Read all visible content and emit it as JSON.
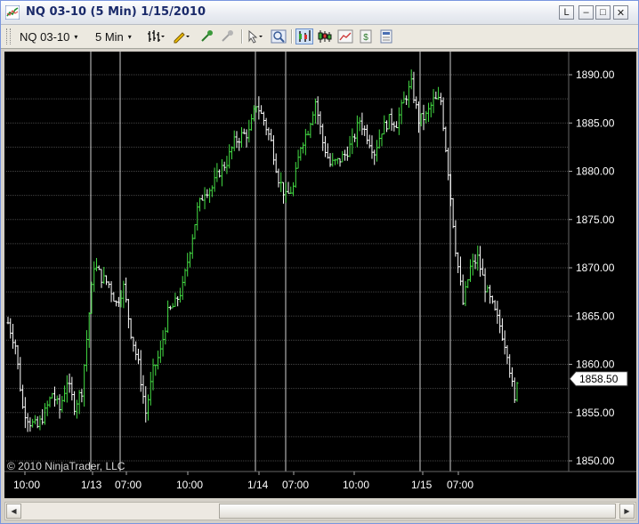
{
  "window": {
    "title": "NQ 03-10 (5 Min)  1/15/2010",
    "buttons": {
      "link": "L",
      "minimize": "‒",
      "maximize": "□",
      "close": "✕"
    }
  },
  "toolbar": {
    "instrument": "NQ 03-10",
    "interval": "5 Min",
    "caret": "▾",
    "icons": [
      "bar-type-icon",
      "pencil-draw-icon",
      "crosshair-icon",
      "pin-icon",
      "pointer-icon",
      "zoom-icon",
      "data-box-icon",
      "candlestick-icon",
      "chart-properties-icon",
      "strategy-icon",
      "indicator-icon"
    ]
  },
  "chart_data": {
    "type": "ohlc",
    "y_ticks": [
      "1890.00",
      "1885.00",
      "1880.00",
      "1875.00",
      "1870.00",
      "1865.00",
      "1860.00",
      "1855.00",
      "1850.00"
    ],
    "ylim": [
      1849.5,
      1891.5
    ],
    "x_ticks": [
      "10:00",
      "1/13",
      "07:00",
      "10:00",
      "1/14",
      "07:00",
      "10:00",
      "1/15",
      "07:00"
    ],
    "session_lines": 9,
    "last_price": "1858.50",
    "colors": {
      "up": "#44dd44",
      "down": "#ffffff",
      "grid": "#444444",
      "background": "#000000"
    },
    "close_path": [
      {
        "bar": 0,
        "price": 1864.3
      },
      {
        "bar": 3,
        "price": 1862.0
      },
      {
        "bar": 6,
        "price": 1855.5
      },
      {
        "bar": 9,
        "price": 1854.0
      },
      {
        "bar": 12,
        "price": 1853.5
      },
      {
        "bar": 15,
        "price": 1855.0
      },
      {
        "bar": 18,
        "price": 1857.0
      },
      {
        "bar": 21,
        "price": 1855.3
      },
      {
        "bar": 24,
        "price": 1858.3
      },
      {
        "bar": 27,
        "price": 1855.7
      },
      {
        "bar": 30,
        "price": 1857.3
      },
      {
        "bar": 33,
        "price": 1865.3
      },
      {
        "bar": 35,
        "price": 1870.3
      },
      {
        "bar": 38,
        "price": 1869.0
      },
      {
        "bar": 41,
        "price": 1868.3
      },
      {
        "bar": 44,
        "price": 1866.3
      },
      {
        "bar": 47,
        "price": 1868.0
      },
      {
        "bar": 50,
        "price": 1863.3
      },
      {
        "bar": 53,
        "price": 1860.0
      },
      {
        "bar": 56,
        "price": 1855.0
      },
      {
        "bar": 59,
        "price": 1859.3
      },
      {
        "bar": 62,
        "price": 1861.3
      },
      {
        "bar": 65,
        "price": 1865.3
      },
      {
        "bar": 68,
        "price": 1866.3
      },
      {
        "bar": 71,
        "price": 1868.0
      },
      {
        "bar": 74,
        "price": 1872.0
      },
      {
        "bar": 77,
        "price": 1876.0
      },
      {
        "bar": 80,
        "price": 1878.0
      },
      {
        "bar": 83,
        "price": 1878.3
      },
      {
        "bar": 86,
        "price": 1880.0
      },
      {
        "bar": 89,
        "price": 1881.0
      },
      {
        "bar": 92,
        "price": 1883.0
      },
      {
        "bar": 95,
        "price": 1883.7
      },
      {
        "bar": 98,
        "price": 1884.0
      },
      {
        "bar": 101,
        "price": 1887.0
      },
      {
        "bar": 104,
        "price": 1885.3
      },
      {
        "bar": 107,
        "price": 1883.0
      },
      {
        "bar": 110,
        "price": 1879.3
      },
      {
        "bar": 113,
        "price": 1877.3
      },
      {
        "bar": 116,
        "price": 1878.3
      },
      {
        "bar": 119,
        "price": 1882.7
      },
      {
        "bar": 122,
        "price": 1884.3
      },
      {
        "bar": 125,
        "price": 1887.3
      },
      {
        "bar": 128,
        "price": 1883.0
      },
      {
        "bar": 131,
        "price": 1880.7
      },
      {
        "bar": 134,
        "price": 1881.0
      },
      {
        "bar": 137,
        "price": 1881.7
      },
      {
        "bar": 140,
        "price": 1883.0
      },
      {
        "bar": 143,
        "price": 1885.3
      },
      {
        "bar": 146,
        "price": 1883.7
      },
      {
        "bar": 149,
        "price": 1882.0
      },
      {
        "bar": 152,
        "price": 1884.3
      },
      {
        "bar": 155,
        "price": 1885.3
      },
      {
        "bar": 158,
        "price": 1885.0
      },
      {
        "bar": 161,
        "price": 1887.3
      },
      {
        "bar": 164,
        "price": 1889.0
      },
      {
        "bar": 167,
        "price": 1885.3
      },
      {
        "bar": 170,
        "price": 1885.7
      },
      {
        "bar": 173,
        "price": 1887.3
      },
      {
        "bar": 176,
        "price": 1887.3
      },
      {
        "bar": 179,
        "price": 1880.0
      },
      {
        "bar": 182,
        "price": 1872.0
      },
      {
        "bar": 185,
        "price": 1866.3
      },
      {
        "bar": 188,
        "price": 1870.0
      },
      {
        "bar": 191,
        "price": 1871.0
      },
      {
        "bar": 194,
        "price": 1868.0
      },
      {
        "bar": 197,
        "price": 1866.0
      },
      {
        "bar": 200,
        "price": 1864.0
      },
      {
        "bar": 203,
        "price": 1861.3
      },
      {
        "bar": 206,
        "price": 1856.0
      },
      {
        "bar": 207,
        "price": 1858.5
      }
    ]
  },
  "copyright": "© 2010 NinjaTrader, LLC"
}
